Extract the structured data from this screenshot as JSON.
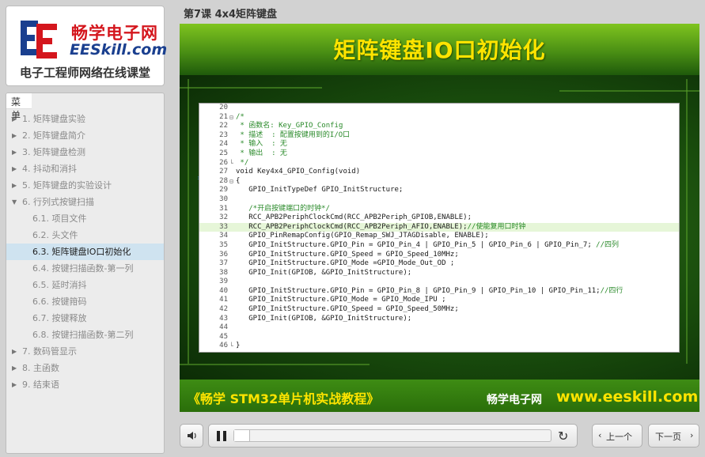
{
  "logo": {
    "cn_name": "畅学电子网",
    "en_name": "EESkill.com",
    "tagline": "电子工程师网络在线课堂"
  },
  "menu": {
    "header": "菜单",
    "items": [
      {
        "label": "1. 矩阵键盘实验",
        "level": 1,
        "expanded": false
      },
      {
        "label": "2. 矩阵键盘简介",
        "level": 1,
        "expanded": false
      },
      {
        "label": "3. 矩阵键盘检测",
        "level": 1,
        "expanded": false
      },
      {
        "label": "4. 抖动和消抖",
        "level": 1,
        "expanded": false
      },
      {
        "label": "5. 矩阵键盘的实验设计",
        "level": 1,
        "expanded": false
      },
      {
        "label": "6. 行列式按键扫描",
        "level": 1,
        "expanded": true
      },
      {
        "label": "6.1. 项目文件",
        "level": 2
      },
      {
        "label": "6.2. 头文件",
        "level": 2
      },
      {
        "label": "6.3. 矩阵键盘IO口初始化",
        "level": 2,
        "active": true
      },
      {
        "label": "6.4. 按键扫描函数-第一列",
        "level": 2
      },
      {
        "label": "6.5. 延时消抖",
        "level": 2
      },
      {
        "label": "6.6. 按键箝码",
        "level": 2
      },
      {
        "label": "6.7. 按键释放",
        "level": 2
      },
      {
        "label": "6.8. 按键扫描函数-第二列",
        "level": 2
      },
      {
        "label": "7. 数码管显示",
        "level": 1,
        "expanded": false
      },
      {
        "label": "8. 主函数",
        "level": 1,
        "expanded": false
      },
      {
        "label": "9. 结束语",
        "level": 1,
        "expanded": false
      }
    ]
  },
  "course_title": "第7课 4x4矩阵键盘",
  "slide": {
    "title": "矩阵键盘IO口初始化",
    "book": "《畅学 STM32单片机实战教程》",
    "site_cn": "畅学电子网",
    "site_url": "www.eeskill.com",
    "code": [
      {
        "n": "20",
        "t": ""
      },
      {
        "n": "21",
        "t": "/*",
        "c": 1,
        "f": "⊟"
      },
      {
        "n": "22",
        "t": " * 函数名: Key_GPIO_Config",
        "c": 1
      },
      {
        "n": "23",
        "t": " * 描述  : 配置按键用到的I/O口",
        "c": 1
      },
      {
        "n": "24",
        "t": " * 输入  : 无",
        "c": 1
      },
      {
        "n": "25",
        "t": " * 输出  : 无",
        "c": 1
      },
      {
        "n": "26",
        "t": " */",
        "c": 1,
        "f": "└"
      },
      {
        "n": "27",
        "t": "void Key4x4_GPIO_Config(void)"
      },
      {
        "n": "28",
        "t": "{",
        "f": "⊟"
      },
      {
        "n": "29",
        "t": "   GPIO_InitTypeDef GPIO_InitStructure;"
      },
      {
        "n": "30",
        "t": ""
      },
      {
        "n": "31",
        "t": "   /*开启按键端口的时钟*/",
        "c": 1
      },
      {
        "n": "32",
        "t": "   RCC_APB2PeriphClockCmd(RCC_APB2Periph_GPIOB,ENABLE);"
      },
      {
        "n": "33",
        "t": "   RCC_APB2PeriphClockCmd(RCC_APB2Periph_AFIO,ENABLE);",
        "cm": "//使能复用口时钟",
        "hl": 1
      },
      {
        "n": "34",
        "t": "   GPIO_PinRemapConfig(GPIO_Remap_SWJ_JTAGDisable, ENABLE);"
      },
      {
        "n": "35",
        "t": "   GPIO_InitStructure.GPIO_Pin = GPIO_Pin_4 | GPIO_Pin_5 | GPIO_Pin_6 | GPIO_Pin_7;",
        "cm": " //四列"
      },
      {
        "n": "36",
        "t": "   GPIO_InitStructure.GPIO_Speed = GPIO_Speed_10MHz;"
      },
      {
        "n": "37",
        "t": "   GPIO_InitStructure.GPIO_Mode =GPIO_Mode_Out_OD ;"
      },
      {
        "n": "38",
        "t": "   GPIO_Init(GPIOB, &GPIO_InitStructure);"
      },
      {
        "n": "39",
        "t": ""
      },
      {
        "n": "40",
        "t": "   GPIO_InitStructure.GPIO_Pin = GPIO_Pin_8 | GPIO_Pin_9 | GPIO_Pin_10 | GPIO_Pin_11;",
        "cm": "//四行"
      },
      {
        "n": "41",
        "t": "   GPIO_InitStructure.GPIO_Mode = GPIO_Mode_IPU ;"
      },
      {
        "n": "42",
        "t": "   GPIO_InitStructure.GPIO_Speed = GPIO_Speed_50MHz;"
      },
      {
        "n": "43",
        "t": "   GPIO_Init(GPIOB, &GPIO_InitStructure);"
      },
      {
        "n": "44",
        "t": ""
      },
      {
        "n": "45",
        "t": ""
      },
      {
        "n": "46",
        "t": "}",
        "f": "└"
      }
    ]
  },
  "controls": {
    "prev_label": "上一个",
    "next_label": "下一页",
    "progress": 0.05
  }
}
